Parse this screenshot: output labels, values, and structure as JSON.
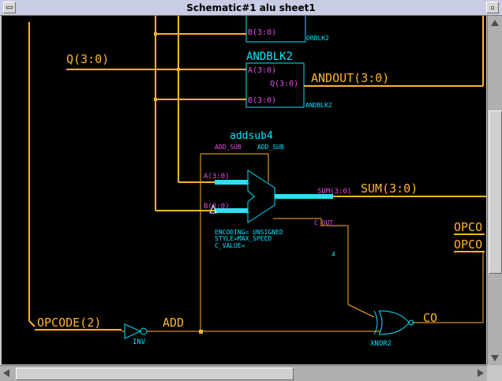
{
  "window": {
    "title": "Schematic#1 alu sheet1"
  },
  "schematic": {
    "nets": {
      "q": "Q(3:0)",
      "andout": "ANDOUT(3:0)",
      "sum": "SUM(3:0)",
      "opcode": "OPCODE(2)",
      "add": "ADD",
      "co": "CO",
      "opcode_right_1": "OPCO",
      "opcode_right_2": "OPCO"
    },
    "orblk2": {
      "name": "ORBLK2",
      "pin_b": "B(3:0)"
    },
    "andblk2": {
      "title": "ANDBLK2",
      "name": "ANDBLK2",
      "pin_a": "A(3:0)",
      "pin_b": "B(3:0)",
      "pin_q": "Q(3:0)"
    },
    "addsub4": {
      "title": "addsub4",
      "add_sub_top": "ADD_SUB",
      "add_sub_pin": "ADD_SUB",
      "pin_a": "A(3:0)",
      "pin_b": "B(3:0)",
      "pin_sum": "SUM(3:0)",
      "pin_cout": "C_OUT",
      "attr_encoding": "ENCODING=    UNSIGNED",
      "attr_style": "STYLE=MAX_SPEED",
      "attr_cvalue": "C_VALUE=",
      "plus_1": "+",
      "plus_2": "+"
    },
    "inv": {
      "name": "INV"
    },
    "xnor2": {
      "name": "XNOR2"
    },
    "marker": "4"
  },
  "colors": {
    "canvas_bg": "#000000",
    "wire": "#ffb429",
    "bus_thick": "#27e4f2",
    "symbol": "#00e3ff",
    "pin_label": "#e64ee6"
  }
}
